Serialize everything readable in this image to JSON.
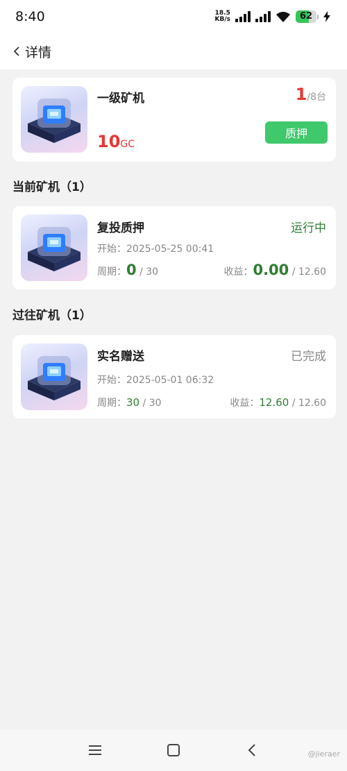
{
  "status_bar": {
    "time": "8:40",
    "net_speed_value": "18.5",
    "net_speed_unit": "KB/s",
    "battery": "62",
    "battery_level": 0.62
  },
  "header": {
    "title": "详情"
  },
  "summary": {
    "name": "一级矿机",
    "count_current": "1",
    "count_total": "/8台",
    "price": "10",
    "price_unit": "GC",
    "pledge_button": "质押"
  },
  "sections": {
    "current_title": "当前矿机（1）",
    "past_title": "过往矿机（1）"
  },
  "current_miner": {
    "name": "复投质押",
    "status": "运行中",
    "start_label": "开始：",
    "start_time": "2025-05-25 00:41",
    "period_label": "周期：",
    "period_value": "0",
    "period_total": "/ 30",
    "income_label": "收益：",
    "income_value": "0.00",
    "income_total": "/ 12.60"
  },
  "past_miner": {
    "name": "实名赠送",
    "status": "已完成",
    "start_label": "开始：",
    "start_time": "2025-05-01 06:32",
    "period_label": "周期：",
    "period_value": "30",
    "period_total": "/ 30",
    "income_label": "收益：",
    "income_value": "12.60",
    "income_total": "/ 12.60"
  },
  "watermark": "@jieraer",
  "colors": {
    "accent_green": "#3fc86c",
    "status_green": "#2e7d32",
    "count_red": "#e53935",
    "battery_green": "#34c759"
  }
}
